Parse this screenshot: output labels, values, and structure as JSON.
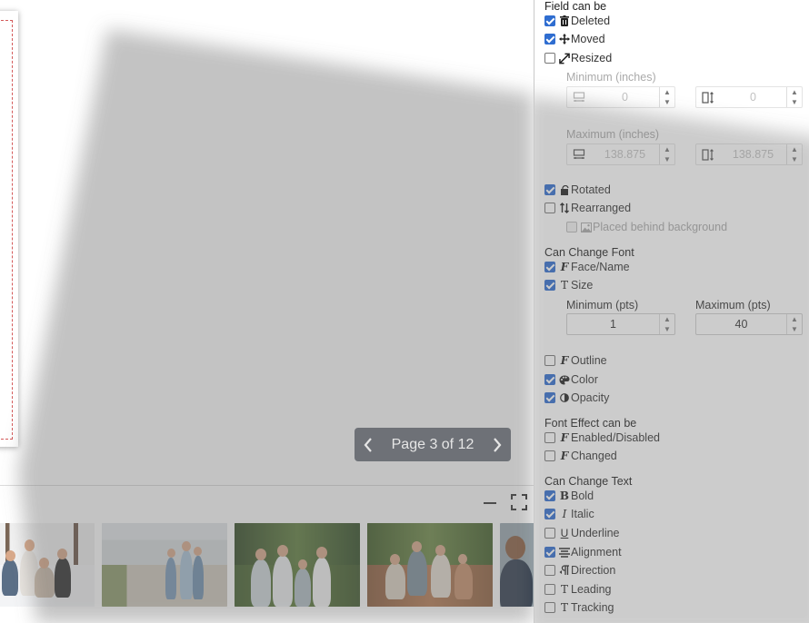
{
  "pager": {
    "label": "Page 3 of 12",
    "prev_icon": "chevron-left-icon",
    "next_icon": "chevron-right-icon"
  },
  "filmstrip": {
    "minimize_icon": "minimize-icon",
    "fullscreen_icon": "fullscreen-icon",
    "thumbnails": [
      {
        "name": "family-snow-photo"
      },
      {
        "name": "family-beach-photo"
      },
      {
        "name": "family-forest-photo"
      },
      {
        "name": "family-picnic-photo"
      },
      {
        "name": "man-portrait-photo"
      }
    ]
  },
  "panel": {
    "field_can_be": {
      "title": "Field can be",
      "deleted": {
        "label": "Deleted",
        "checked": true,
        "icon": "trash-icon"
      },
      "moved": {
        "label": "Moved",
        "checked": true,
        "icon": "move-icon"
      },
      "resized": {
        "label": "Resized",
        "checked": false,
        "icon": "resize-icon"
      },
      "minimum_label": "Minimum (inches)",
      "min_width": "0",
      "min_height": "0",
      "maximum_label": "Maximum (inches)",
      "max_width": "138.875",
      "max_height": "138.875",
      "rotated": {
        "label": "Rotated",
        "checked": true,
        "icon": "rotate-icon"
      },
      "rearranged": {
        "label": "Rearranged",
        "checked": false,
        "icon": "rearrange-icon"
      },
      "behind_background": {
        "label": "Placed behind background",
        "checked": false,
        "icon": "image-icon"
      }
    },
    "can_change_font": {
      "title": "Can Change Font",
      "face": {
        "label": "Face/Name",
        "checked": true,
        "icon": "font-icon"
      },
      "size": {
        "label": "Size",
        "checked": true,
        "icon": "font-size-icon"
      },
      "min_label": "Minimum (pts)",
      "min_value": "1",
      "max_label": "Maximum (pts)",
      "max_value": "40",
      "outline": {
        "label": "Outline",
        "checked": false,
        "icon": "font-icon"
      },
      "color": {
        "label": "Color",
        "checked": true,
        "icon": "palette-icon"
      },
      "opacity": {
        "label": "Opacity",
        "checked": true,
        "icon": "opacity-icon"
      }
    },
    "font_effect": {
      "title": "Font Effect can be",
      "enabled": {
        "label": "Enabled/Disabled",
        "checked": false,
        "icon": "font-icon"
      },
      "changed": {
        "label": "Changed",
        "checked": false,
        "icon": "font-icon"
      }
    },
    "can_change_text": {
      "title": "Can Change Text",
      "bold": {
        "label": "Bold",
        "checked": true,
        "icon": "bold-icon"
      },
      "italic": {
        "label": "Italic",
        "checked": true,
        "icon": "italic-icon"
      },
      "underline": {
        "label": "Underline",
        "checked": false,
        "icon": "underline-icon"
      },
      "alignment": {
        "label": "Alignment",
        "checked": true,
        "icon": "align-icon"
      },
      "direction": {
        "label": "Direction",
        "checked": false,
        "icon": "direction-icon"
      },
      "leading": {
        "label": "Leading",
        "checked": false,
        "icon": "leading-icon"
      },
      "tracking": {
        "label": "Tracking",
        "checked": false,
        "icon": "tracking-icon"
      }
    }
  },
  "colors": {
    "checkbox_on": "#2f6dd0",
    "pager_bg": "#6e7177",
    "overlay": "#808080"
  }
}
